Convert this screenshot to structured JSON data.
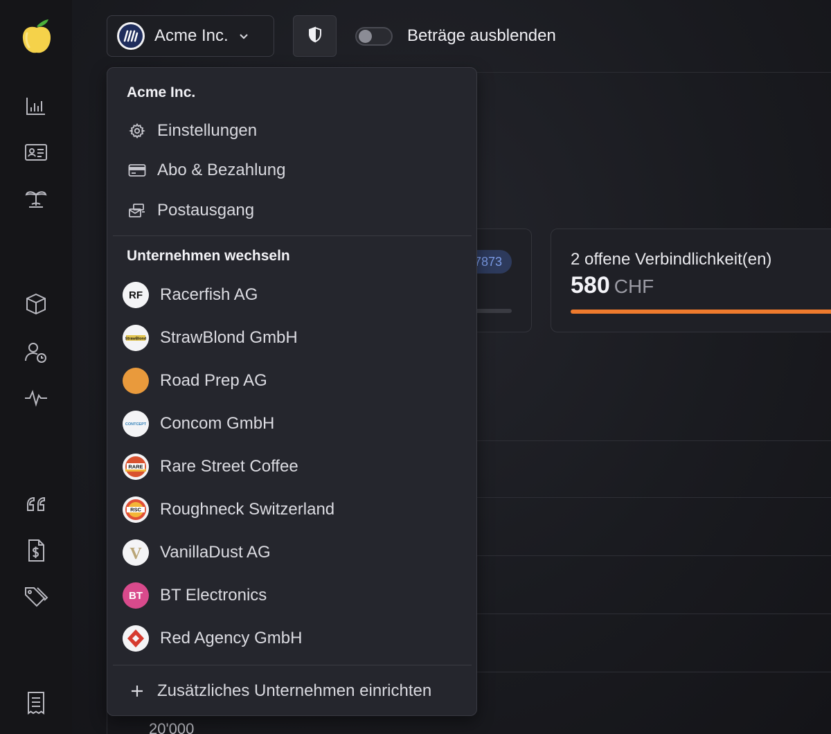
{
  "header": {
    "current_company": "Acme Inc.",
    "hide_amounts_label": "Beträge ausblenden",
    "hide_amounts_enabled": false
  },
  "dropdown": {
    "account_heading": "Acme Inc.",
    "account_items": [
      {
        "label": "Einstellungen",
        "icon": "gear-icon"
      },
      {
        "label": "Abo & Bezahlung",
        "icon": "credit-card-icon"
      },
      {
        "label": "Postausgang",
        "icon": "outbox-icon"
      }
    ],
    "switch_heading": "Unternehmen wechseln",
    "companies": [
      {
        "name": "Racerfish AG",
        "logo_text": "RF"
      },
      {
        "name": "StrawBlond GmbH",
        "logo_text": "StrawBlond"
      },
      {
        "name": "Road Prep AG",
        "logo_text": ""
      },
      {
        "name": "Concom GmbH",
        "logo_text": "CONTCEPT"
      },
      {
        "name": "Rare Street Coffee",
        "logo_text": "RARE"
      },
      {
        "name": "Roughneck Switzerland",
        "logo_text": "RSC"
      },
      {
        "name": "VanillaDust AG",
        "logo_text": "V"
      },
      {
        "name": "BT Electronics",
        "logo_text": "BT"
      },
      {
        "name": "Red Agency GmbH",
        "logo_text": ""
      }
    ],
    "add_company_label": "Zusätzliches Unternehmen einrichten"
  },
  "cards": {
    "partial_pill": "7873",
    "liabilities_title": "2 offene Verbindlichkeit(en)",
    "liabilities_amount": "580",
    "liabilities_currency": "CHF",
    "liabilities_progress": 1.0
  },
  "chart": {
    "axis_label": "20'000"
  },
  "colors": {
    "accent_orange": "#ee7a2d",
    "pill_blue": "#7b9be6",
    "bt_pink": "#d94a8c"
  }
}
